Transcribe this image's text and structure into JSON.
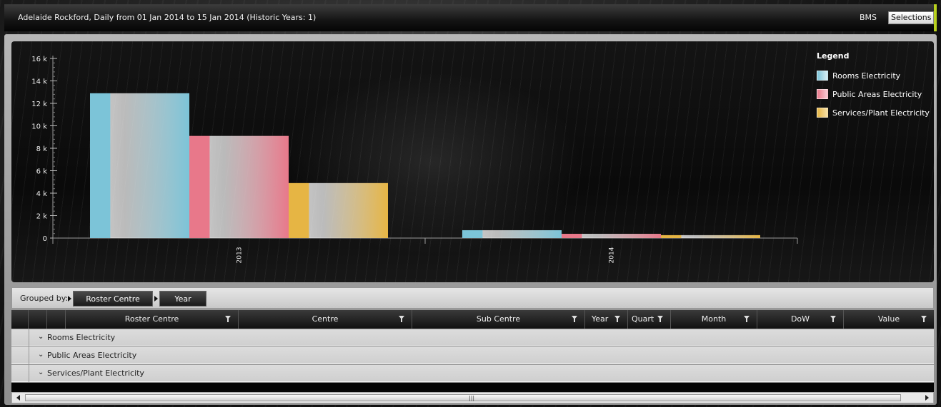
{
  "header": {
    "title": "Adelaide Rockford, Daily from 01 Jan 2014 to 15 Jan 2014 (Historic Years: 1)",
    "bms_label": "BMS",
    "selections_label": "Selections"
  },
  "colors": {
    "rooms": "#7cc4d8",
    "public": "#e8788a",
    "services": "#e6b544",
    "accent": "#b8d11e"
  },
  "chart_data": {
    "type": "bar",
    "categories": [
      "2013",
      "2014"
    ],
    "series": [
      {
        "name": "Rooms Electricity",
        "values": [
          12900,
          700
        ]
      },
      {
        "name": "Public Areas Electricity",
        "values": [
          9100,
          380
        ]
      },
      {
        "name": "Services/Plant Electricity",
        "values": [
          4900,
          260
        ]
      }
    ],
    "ylim": [
      0,
      16000
    ],
    "yticks": [
      "0",
      "2 k",
      "4 k",
      "6 k",
      "8 k",
      "10 k",
      "12 k",
      "14 k",
      "16 k"
    ],
    "legend_title": "Legend",
    "legend_position": "top-right"
  },
  "grouping": {
    "label": "Grouped by:",
    "chips": [
      "Roster Centre",
      "Year"
    ]
  },
  "grid": {
    "columns": [
      "Roster Centre",
      "Centre",
      "Sub Centre",
      "Year",
      "Quart",
      "Month",
      "DoW",
      "Value"
    ],
    "rows": [
      "Rooms Electricity",
      "Public Areas Electricity",
      "Services/Plant Electricity"
    ]
  },
  "icons": {
    "expand": "chevron-down-icon",
    "filter": "filter-icon",
    "scroll_left": "arrow-left-icon",
    "scroll_right": "arrow-right-icon"
  }
}
